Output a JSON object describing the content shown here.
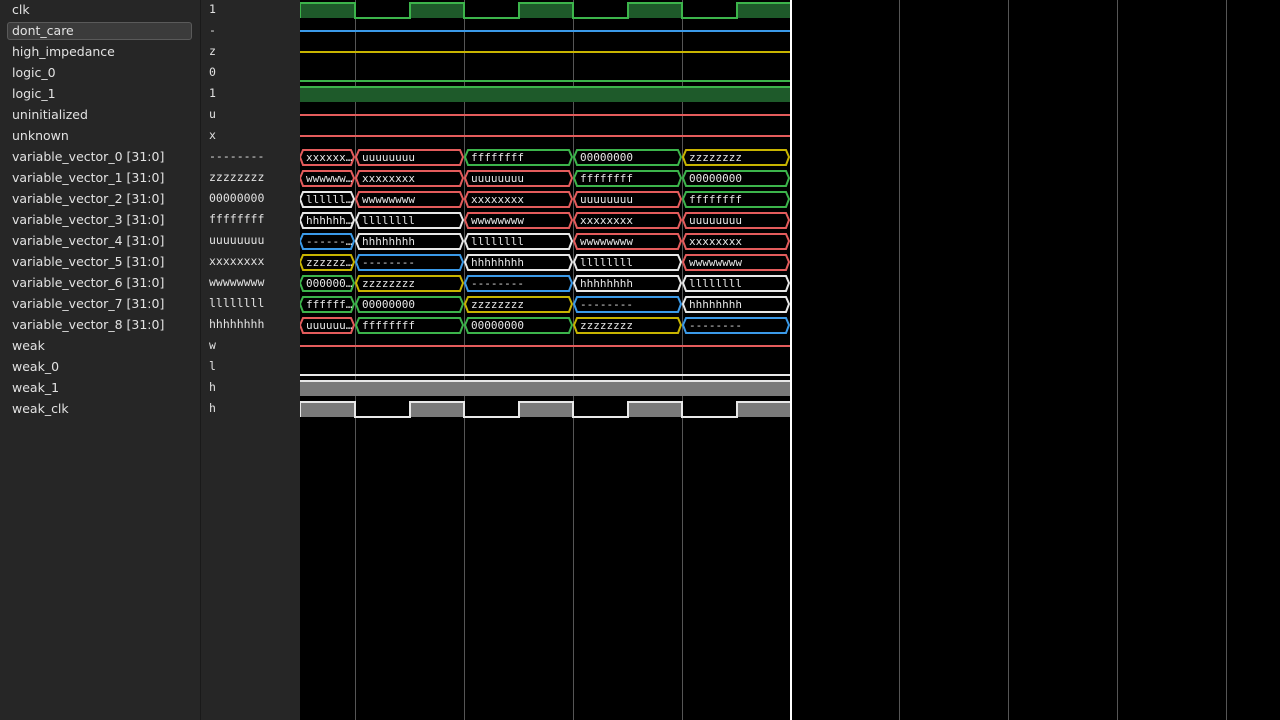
{
  "colors": {
    "green": "#3cb44b",
    "green_fill": "#1e5a2a",
    "blue": "#3b9ae8",
    "yellow": "#c8b400",
    "red": "#e45c5c",
    "white": "#e8e8e8",
    "gray_fill": "#7a7a7a",
    "grid": "#555555",
    "cursor": "#ffffff"
  },
  "signals": [
    {
      "name": "clk",
      "value": "1",
      "type": "clk"
    },
    {
      "name": "dont_care",
      "value": "-",
      "type": "line",
      "color": "blue",
      "selected": true
    },
    {
      "name": "high_impedance",
      "value": "z",
      "type": "line",
      "color": "yellow"
    },
    {
      "name": "logic_0",
      "value": "0",
      "type": "low",
      "color": "green"
    },
    {
      "name": "logic_1",
      "value": "1",
      "type": "high"
    },
    {
      "name": "uninitialized",
      "value": "u",
      "type": "line",
      "color": "red"
    },
    {
      "name": "unknown",
      "value": "x",
      "type": "line",
      "color": "red"
    },
    {
      "name": "variable_vector_0 [31:0]",
      "value": "--------",
      "type": "bus",
      "segments": [
        {
          "text": "xxxxxx…",
          "color": "red"
        },
        {
          "text": "uuuuuuuu",
          "color": "red"
        },
        {
          "text": "ffffffff",
          "color": "green"
        },
        {
          "text": "00000000",
          "color": "green"
        },
        {
          "text": "zzzzzzzz",
          "color": "yellow"
        }
      ]
    },
    {
      "name": "variable_vector_1 [31:0]",
      "value": "zzzzzzzz",
      "type": "bus",
      "segments": [
        {
          "text": "wwwwww…",
          "color": "red"
        },
        {
          "text": "xxxxxxxx",
          "color": "red"
        },
        {
          "text": "uuuuuuuu",
          "color": "red"
        },
        {
          "text": "ffffffff",
          "color": "green"
        },
        {
          "text": "00000000",
          "color": "green"
        }
      ]
    },
    {
      "name": "variable_vector_2 [31:0]",
      "value": "00000000",
      "type": "bus",
      "segments": [
        {
          "text": "llllll…",
          "color": "white"
        },
        {
          "text": "wwwwwwww",
          "color": "red"
        },
        {
          "text": "xxxxxxxx",
          "color": "red"
        },
        {
          "text": "uuuuuuuu",
          "color": "red"
        },
        {
          "text": "ffffffff",
          "color": "green"
        }
      ]
    },
    {
      "name": "variable_vector_3 [31:0]",
      "value": "ffffffff",
      "type": "bus",
      "segments": [
        {
          "text": "hhhhhh…",
          "color": "white"
        },
        {
          "text": "llllllll",
          "color": "white"
        },
        {
          "text": "wwwwwwww",
          "color": "red"
        },
        {
          "text": "xxxxxxxx",
          "color": "red"
        },
        {
          "text": "uuuuuuuu",
          "color": "red"
        }
      ]
    },
    {
      "name": "variable_vector_4 [31:0]",
      "value": "uuuuuuuu",
      "type": "bus",
      "segments": [
        {
          "text": "------…",
          "color": "blue"
        },
        {
          "text": "hhhhhhhh",
          "color": "white"
        },
        {
          "text": "llllllll",
          "color": "white"
        },
        {
          "text": "wwwwwwww",
          "color": "red"
        },
        {
          "text": "xxxxxxxx",
          "color": "red"
        }
      ]
    },
    {
      "name": "variable_vector_5 [31:0]",
      "value": "xxxxxxxx",
      "type": "bus",
      "segments": [
        {
          "text": "zzzzzz…",
          "color": "yellow"
        },
        {
          "text": "--------",
          "color": "blue"
        },
        {
          "text": "hhhhhhhh",
          "color": "white"
        },
        {
          "text": "llllllll",
          "color": "white"
        },
        {
          "text": "wwwwwwww",
          "color": "red"
        }
      ]
    },
    {
      "name": "variable_vector_6 [31:0]",
      "value": "wwwwwwww",
      "type": "bus",
      "segments": [
        {
          "text": "000000…",
          "color": "green"
        },
        {
          "text": "zzzzzzzz",
          "color": "yellow"
        },
        {
          "text": "--------",
          "color": "blue"
        },
        {
          "text": "hhhhhhhh",
          "color": "white"
        },
        {
          "text": "llllllll",
          "color": "white"
        }
      ]
    },
    {
      "name": "variable_vector_7 [31:0]",
      "value": "llllllll",
      "type": "bus",
      "segments": [
        {
          "text": "ffffff…",
          "color": "green"
        },
        {
          "text": "00000000",
          "color": "green"
        },
        {
          "text": "zzzzzzzz",
          "color": "yellow"
        },
        {
          "text": "--------",
          "color": "blue"
        },
        {
          "text": "hhhhhhhh",
          "color": "white"
        }
      ]
    },
    {
      "name": "variable_vector_8 [31:0]",
      "value": "hhhhhhhh",
      "type": "bus",
      "segments": [
        {
          "text": "uuuuuu…",
          "color": "red"
        },
        {
          "text": "ffffffff",
          "color": "green"
        },
        {
          "text": "00000000",
          "color": "green"
        },
        {
          "text": "zzzzzzzz",
          "color": "yellow"
        },
        {
          "text": "--------",
          "color": "blue"
        }
      ]
    },
    {
      "name": "weak",
      "value": "w",
      "type": "line",
      "color": "red"
    },
    {
      "name": "weak_0",
      "value": "l",
      "type": "low",
      "color": "white"
    },
    {
      "name": "weak_1",
      "value": "h",
      "type": "gray_high"
    },
    {
      "name": "weak_clk",
      "value": "h",
      "type": "weak_clk"
    }
  ]
}
